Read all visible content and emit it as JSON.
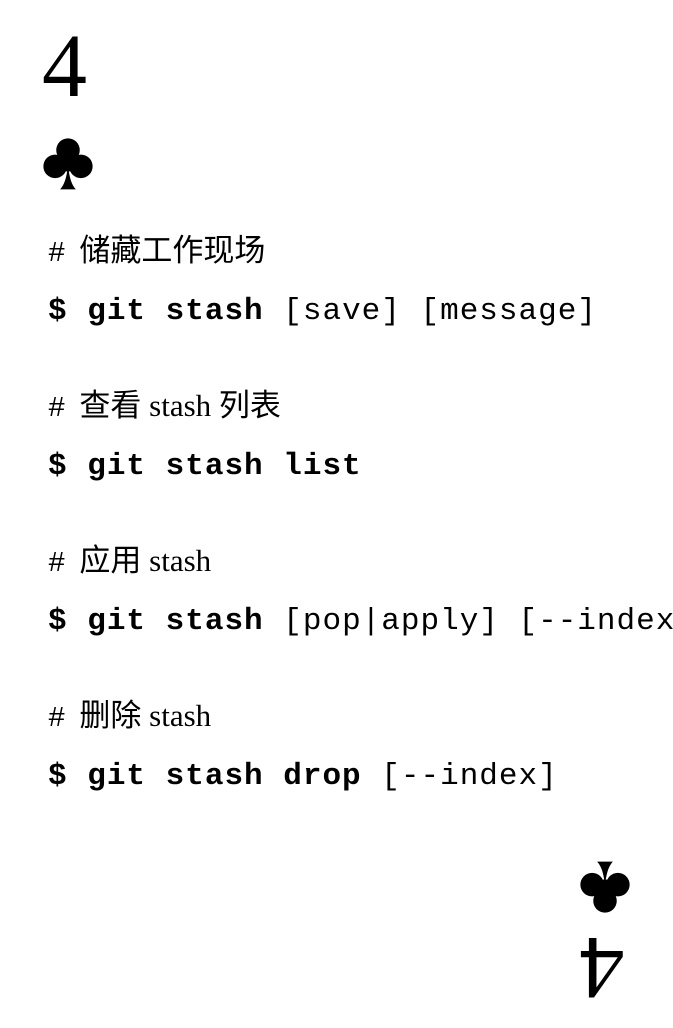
{
  "card": {
    "rank": "4",
    "suit_icon": "club-icon",
    "suit_color": "#000000",
    "background_color": "#ffffff"
  },
  "sections": [
    {
      "comment": "储藏工作现场",
      "prompt": "$",
      "command": "git stash",
      "options": "[save] [message]"
    },
    {
      "comment": "查看 stash 列表",
      "prompt": "$",
      "command": "git stash list",
      "options": ""
    },
    {
      "comment": "应用 stash",
      "prompt": "$",
      "command": "git stash",
      "options": "[pop|apply] [--index]"
    },
    {
      "comment": "删除 stash",
      "prompt": "$",
      "command": "git stash drop",
      "options": "[--index]"
    }
  ],
  "comment_prefix": "#"
}
